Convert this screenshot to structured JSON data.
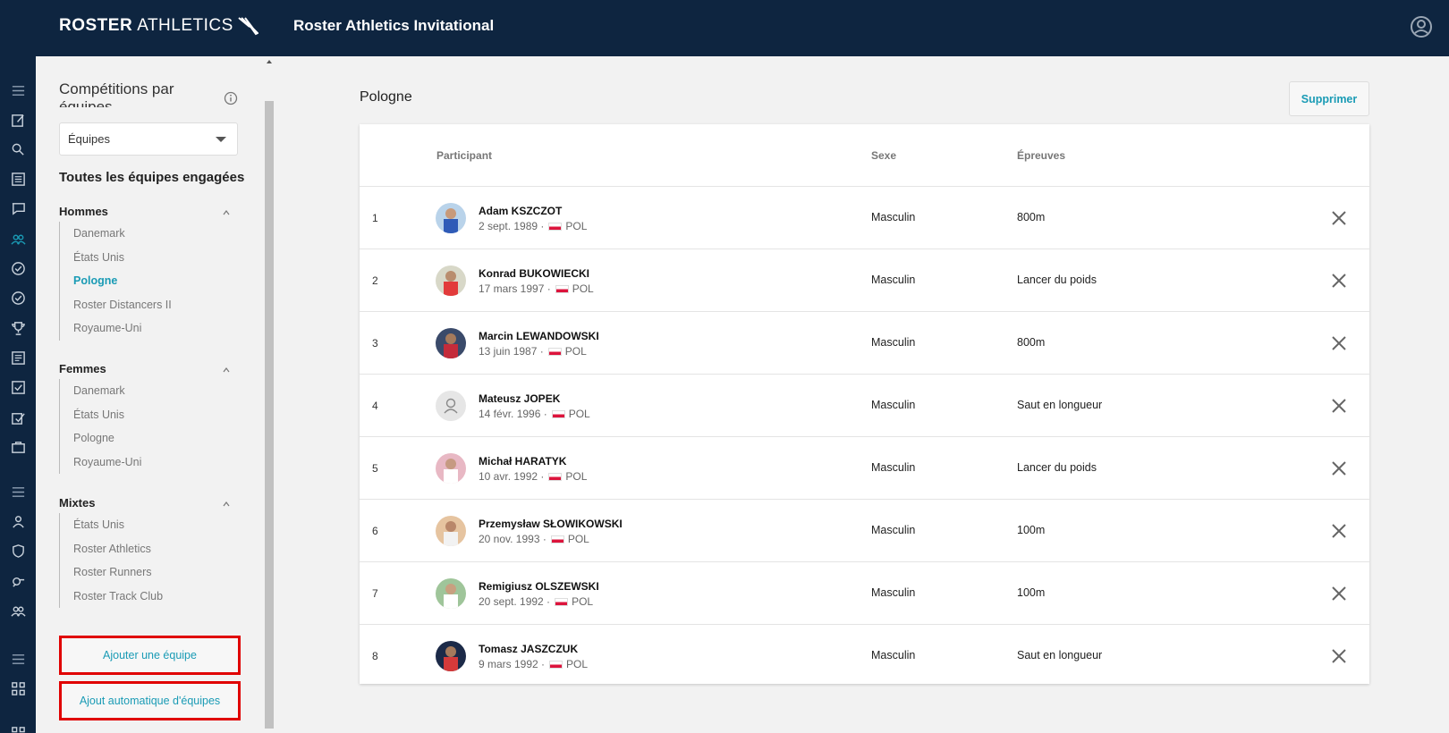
{
  "brand": {
    "name_bold": "ROSTER",
    "name_thin": "ATHLETICS"
  },
  "app_title": "Roster Athletics Invitational",
  "sidebar": {
    "title": "Compétitions par équipes",
    "filter_value": "Équipes",
    "all_teams_label": "Toutes les équipes engagées",
    "groups": [
      {
        "label": "Hommes",
        "items": [
          "Danemark",
          "États Unis",
          "Pologne",
          "Roster Distancers II",
          "Royaume-Uni"
        ],
        "active_index": 2
      },
      {
        "label": "Femmes",
        "items": [
          "Danemark",
          "États Unis",
          "Pologne",
          "Royaume-Uni"
        ],
        "active_index": -1
      },
      {
        "label": "Mixtes",
        "items": [
          "États Unis",
          "Roster Athletics",
          "Roster Runners",
          "Roster Track Club"
        ],
        "active_index": -1
      }
    ],
    "add_team_label": "Ajouter une équipe",
    "auto_add_label": "Ajout automatique d'équipes"
  },
  "main": {
    "team_name": "Pologne",
    "delete_label": "Supprimer",
    "columns": {
      "participant": "Participant",
      "sex": "Sexe",
      "events": "Épreuves"
    },
    "rows": [
      {
        "num": "1",
        "name": "Adam KSZCZOT",
        "birth": "2 sept. 1989 ·",
        "country": "POL",
        "sex": "Masculin",
        "event": "800m",
        "avatar": "photo-blue"
      },
      {
        "num": "2",
        "name": "Konrad BUKOWIECKI",
        "birth": "17 mars 1997 ·",
        "country": "POL",
        "sex": "Masculin",
        "event": "Lancer du poids",
        "avatar": "photo-red"
      },
      {
        "num": "3",
        "name": "Marcin LEWANDOWSKI",
        "birth": "13 juin 1987 ·",
        "country": "POL",
        "sex": "Masculin",
        "event": "800m",
        "avatar": "photo-dark"
      },
      {
        "num": "4",
        "name": "Mateusz JOPEK",
        "birth": "14 févr. 1996 ·",
        "country": "POL",
        "sex": "Masculin",
        "event": "Saut en longueur",
        "avatar": "person-icon"
      },
      {
        "num": "5",
        "name": "Michał HARATYK",
        "birth": "10 avr. 1992 ·",
        "country": "POL",
        "sex": "Masculin",
        "event": "Lancer du poids",
        "avatar": "photo-pink"
      },
      {
        "num": "6",
        "name": "Przemysław SŁOWIKOWSKI",
        "birth": "20 nov. 1993 ·",
        "country": "POL",
        "sex": "Masculin",
        "event": "100m",
        "avatar": "photo-orange"
      },
      {
        "num": "7",
        "name": "Remigiusz OLSZEWSKI",
        "birth": "20 sept. 1992 ·",
        "country": "POL",
        "sex": "Masculin",
        "event": "100m",
        "avatar": "photo-green"
      },
      {
        "num": "8",
        "name": "Tomasz JASZCZUK",
        "birth": "9 mars 1992 ·",
        "country": "POL",
        "sex": "Masculin",
        "event": "Saut en longueur",
        "avatar": "photo-navy"
      }
    ]
  },
  "colors": {
    "topbar": "#0e2540",
    "accent": "#1a9bb5",
    "highlight_border": "#e00000",
    "flag_red": "#dc143c"
  }
}
